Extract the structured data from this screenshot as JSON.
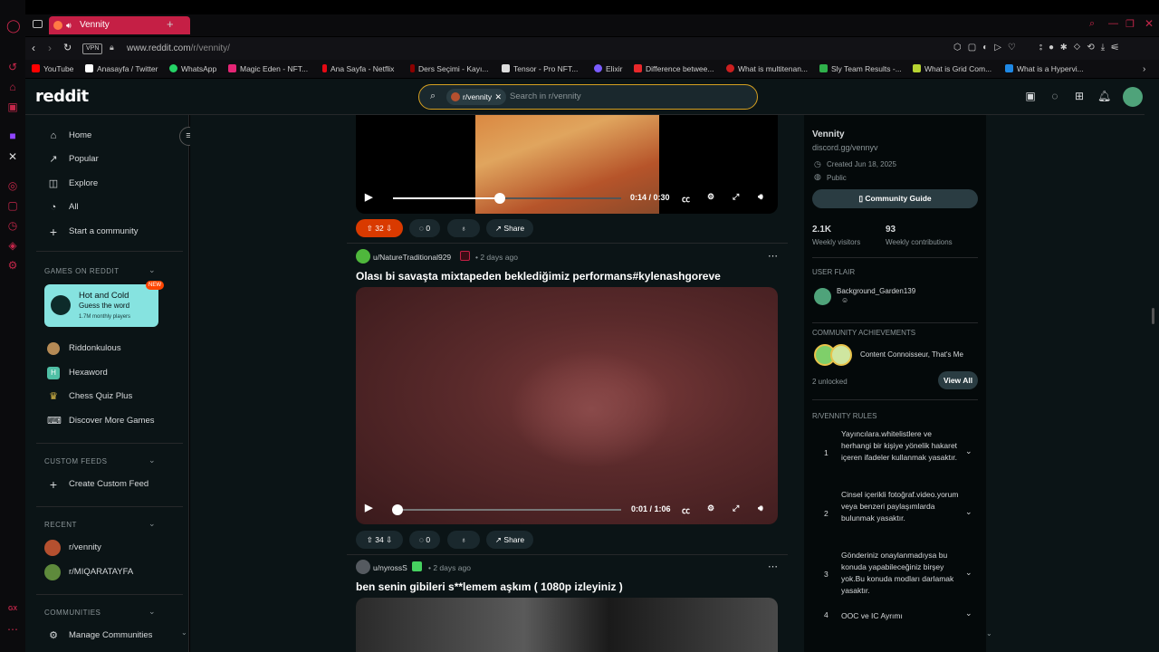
{
  "browser": {
    "tab_title": "Vennity",
    "url_host": "www.reddit.com",
    "url_path": "/r/vennity/",
    "vpn_label": "VPN",
    "gx_label": "GX",
    "bookmarks": [
      {
        "label": "YouTube",
        "color": "#ff0000"
      },
      {
        "label": "Anasayfa / Twitter",
        "color": "#ffffff"
      },
      {
        "label": "WhatsApp",
        "color": "#25d366"
      },
      {
        "label": "Magic Eden - NFT...",
        "color": "#e42575"
      },
      {
        "label": "Ana Sayfa - Netflix",
        "color": "#e50914"
      },
      {
        "label": "Ders Seçimi - Kayı...",
        "color": "#8b0000"
      },
      {
        "label": "Tensor - Pro NFT...",
        "color": "#dddddd"
      },
      {
        "label": "Elixir",
        "color": "#7b5cff"
      },
      {
        "label": "Difference betwee...",
        "color": "#e8282b"
      },
      {
        "label": "What is multitenan...",
        "color": "#cc1f1f"
      },
      {
        "label": "Sly Team Results -...",
        "color": "#2fb04b"
      },
      {
        "label": "What is Grid Com...",
        "color": "#b7d332"
      },
      {
        "label": "What is a Hypervi...",
        "color": "#1e88e5"
      }
    ]
  },
  "header": {
    "logo": "reddit",
    "search_chip": "r/vennity",
    "search_placeholder": "Search in r/vennity"
  },
  "leftnav": {
    "items": [
      {
        "label": "Home",
        "icon": "home-icon"
      },
      {
        "label": "Popular",
        "icon": "popular-icon"
      },
      {
        "label": "Explore",
        "icon": "explore-icon"
      },
      {
        "label": "All",
        "icon": "all-icon"
      },
      {
        "label": "Start a community",
        "icon": "plus-icon"
      }
    ],
    "games_head": "GAMES ON REDDIT",
    "hot_cold": {
      "title": "Hot and Cold",
      "subtitle": "Guess the word",
      "players": "1.7M monthly players",
      "badge": "NEW"
    },
    "games": [
      "Riddonkulous",
      "Hexaword",
      "Chess Quiz Plus",
      "Discover More Games"
    ],
    "custom_head": "CUSTOM FEEDS",
    "create_feed": "Create Custom Feed",
    "recent_head": "RECENT",
    "recent": [
      "r/vennity",
      "r/MIQARATAYFA"
    ],
    "communities_head": "COMMUNITIES",
    "manage": "Manage Communities"
  },
  "posts": [
    {
      "video_time": "0:14 / 0:30",
      "progress": 0.47,
      "upvotes": "32",
      "comments": "0",
      "share": "Share",
      "upvoted": true
    },
    {
      "author": "u/NatureTraditional929",
      "time": "• 2 days ago",
      "title": "Olası bi savaşta mixtapeden beklediğimiz performans#kylenashgoreve",
      "video_time": "0:01 / 1:06",
      "progress": 0.02,
      "upvotes": "34",
      "comments": "0",
      "share": "Share",
      "upvoted": false
    },
    {
      "author": "u/nyrossS",
      "time": "• 2 days ago",
      "title": "ben senin gibileri s**lemem aşkım ( 1080p izleyiniz )"
    }
  ],
  "sidebar": {
    "name": "Vennity",
    "link": "discord.gg/vennyv",
    "created": "Created Jun 18, 2025",
    "visibility": "Public",
    "guide_btn": "Community Guide",
    "visitors": "2.1K",
    "visitors_label": "Weekly visitors",
    "contrib": "93",
    "contrib_label": "Weekly contributions",
    "flair_head": "USER FLAIR",
    "flair_user": "Background_Garden139",
    "ach_head": "COMMUNITY ACHIEVEMENTS",
    "ach_text": "Content Connoisseur, That's Me",
    "ach_unlocked": "2 unlocked",
    "view_all": "View All",
    "rules_head": "R/VENNITY RULES",
    "rules": [
      {
        "n": "1",
        "text": "Yayıncılara.whitelistlere ve herhangi bir kişiye yönelik hakaret içeren ifadeler kullanmak yasaktır."
      },
      {
        "n": "2",
        "text": "Cinsel içerikli fotoğraf.video.yorum veya benzeri paylaşımlarda bulunmak yasaktır."
      },
      {
        "n": "3",
        "text": "Gönderiniz onaylanmadıysa bu konuda yapabileceğiniz birşey yok.Bu konuda modları darlamak yasaktır."
      },
      {
        "n": "4",
        "text": "OOC ve IC Ayrımı"
      }
    ]
  },
  "colors": {
    "accent": "#c51f45",
    "upvote": "#d93a00",
    "bg": "#0b1416"
  }
}
